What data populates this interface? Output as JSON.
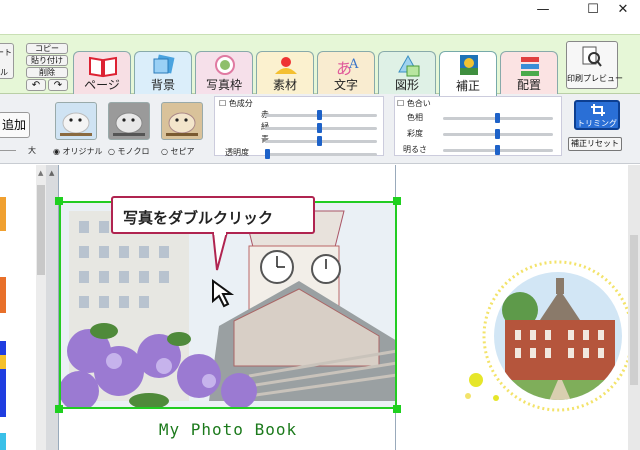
{
  "window": {
    "minimize": "—",
    "maximize": "☐",
    "close": "✕"
  },
  "ribbon": {
    "left_partial_top": "ート",
    "left_partial_bottom": "ル",
    "copy": "コピー",
    "paste": "貼り付け",
    "delete": "削除",
    "undo": "↶",
    "redo": "↷",
    "tabs": [
      {
        "label": "ページ",
        "icon": "page-book-icon"
      },
      {
        "label": "背景",
        "icon": "background-icon"
      },
      {
        "label": "写真枠",
        "icon": "photo-frame-icon"
      },
      {
        "label": "素材",
        "icon": "material-icon"
      },
      {
        "label": "文字",
        "icon": "text-icon"
      },
      {
        "label": "図形",
        "icon": "shape-icon"
      },
      {
        "label": "補正",
        "icon": "correction-icon"
      },
      {
        "label": "配置",
        "icon": "layout-icon"
      }
    ],
    "print_preview": "印刷プレビュー"
  },
  "tools": {
    "add_button": "追加",
    "size_large": "大",
    "filters": [
      "オリジナル",
      "モノクロ",
      "セピア"
    ],
    "selected_filter": "オリジナル",
    "color_component": {
      "checkbox_label": "色成分",
      "sliders": [
        {
          "label": "赤",
          "value": 0.5
        },
        {
          "label": "緑",
          "value": 0.5
        },
        {
          "label": "青",
          "value": 0.5
        },
        {
          "label": "透明度",
          "value": 0.0
        }
      ]
    },
    "color_tone": {
      "checkbox_label": "色合い",
      "sliders": [
        {
          "label": "色相",
          "value": 0.5
        },
        {
          "label": "彩度",
          "value": 0.5
        },
        {
          "label": "明るさ",
          "value": 0.5
        }
      ]
    },
    "trimming": "トリミング",
    "reset_correction": "補正リセット"
  },
  "canvas": {
    "tooltip": "写真をダブルクリック",
    "caption": "My Photo Book",
    "caption_color": "#1c7a1c",
    "handle_color": "#22cc22"
  }
}
